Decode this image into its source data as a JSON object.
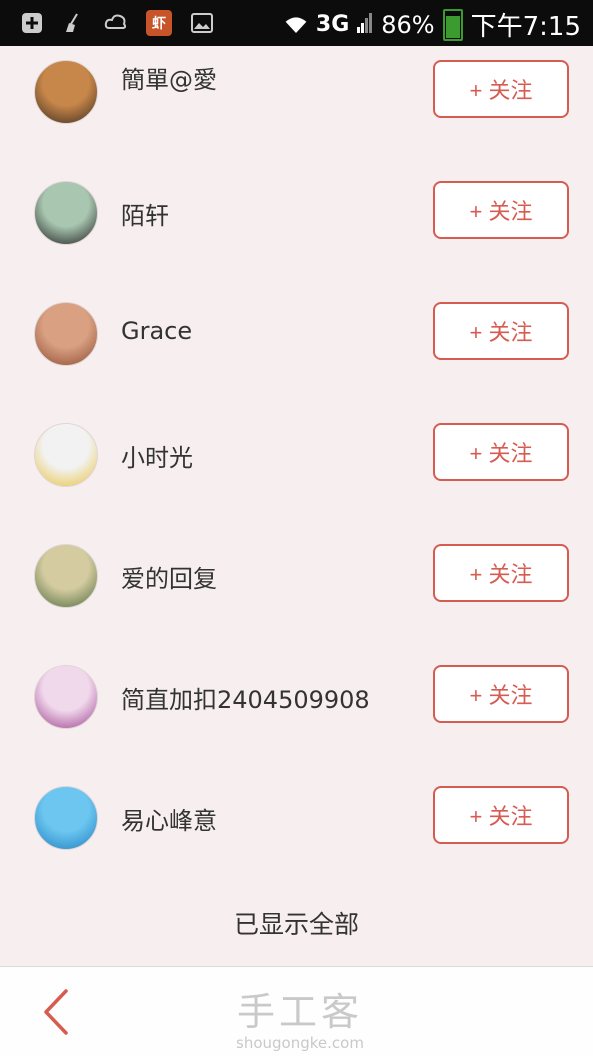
{
  "status_bar": {
    "network": "3G",
    "battery": "86%",
    "time": "下午7:15",
    "app_badge": "虾",
    "icons": [
      "plus-box-icon",
      "broom-icon",
      "cloud-icon",
      "app-icon",
      "image-icon",
      "wifi-icon",
      "signal-icon",
      "battery-icon"
    ]
  },
  "list": {
    "items": [
      {
        "name": "簡單@愛",
        "button": "+ 关注",
        "avatar_colors": [
          "#c8874a",
          "#3a2a1e"
        ]
      },
      {
        "name": "陌轩",
        "button": "+ 关注",
        "avatar_colors": [
          "#a8c6b0",
          "#1a1a1a"
        ]
      },
      {
        "name": "Grace",
        "button": "+ 关注",
        "avatar_colors": [
          "#d9a082",
          "#8b4a30"
        ]
      },
      {
        "name": "小时光",
        "button": "+ 关注",
        "avatar_colors": [
          "#f2f2f2",
          "#e8c13a"
        ]
      },
      {
        "name": "爱的回复",
        "button": "+ 关注",
        "avatar_colors": [
          "#d4cba0",
          "#4a6a3a"
        ]
      },
      {
        "name": "简直加扣2404509908",
        "button": "+ 关注",
        "avatar_colors": [
          "#f1d9ec",
          "#9b3d8e"
        ]
      },
      {
        "name": "易心峰意",
        "button": "+ 关注",
        "avatar_colors": [
          "#6cc6f0",
          "#1f7fc0"
        ]
      }
    ],
    "end_text": "已显示全部"
  },
  "bottom_bar": {
    "watermark_cn": "手工客",
    "watermark_en": "shougongke.com"
  },
  "colors": {
    "accent": "#d65c52",
    "background": "#f7efef"
  }
}
